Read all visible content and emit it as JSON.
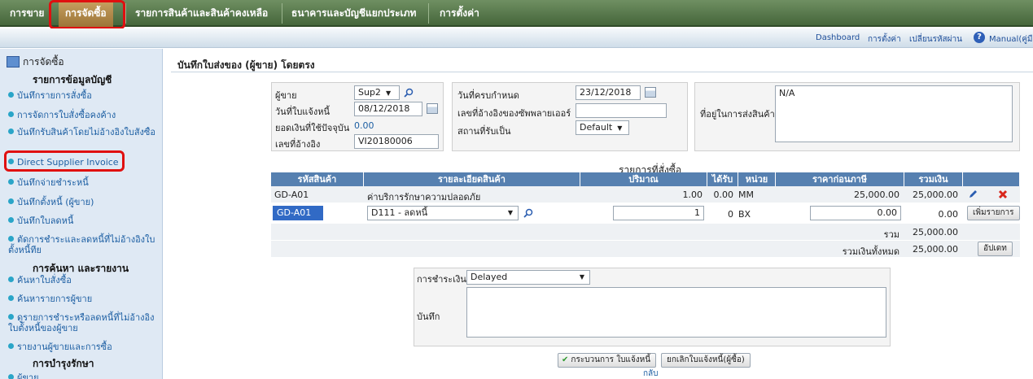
{
  "nav": {
    "tabs": [
      "การขาย",
      "การจัดซื้อ",
      "รายการสินค้าและสินค้าคงเหลือ",
      "ธนาคารและบัญชีแยกประเภท",
      "การตั้งค่า"
    ]
  },
  "subnav": {
    "links": [
      "Dashboard",
      "การตั้งค่า",
      "เปลี่ยนรหัสผ่าน",
      "Manual(คู่มือ"
    ]
  },
  "sidebar": {
    "header": "การจัดซื้อ",
    "section_accounts": "รายการข้อมูลบัญชี",
    "items": [
      "บันทึกรายการสั่งซื้อ",
      "การจัดการใบสั่งซื้อคงค้าง",
      "บันทึกรับสินค้าโดยไม่อ้างอิงใบสั่งซื้อ",
      "Direct Supplier Invoice",
      "บันทึกจ่ายชำระหนี้",
      "บันทึกตั้งหนี้ (ผู้ขาย)",
      "บันทึกใบลดหนี้",
      "ตัดการชำระและลดหนี้ที่ไม่อ้างอิงใบตั้งหนี้ทีย"
    ],
    "section_reports": "การค้นหา และรายงาน",
    "report_items": [
      "ค้นหาใบสั่งซื้อ",
      "ค้นหารายการผู้ขาย",
      "ดูรายการชำระหรือลดหนี้ที่ไม่อ้างอิงใบตั้งหนี้ของผู้ขาย",
      "รายงานผู้ขายและการซื้อ"
    ],
    "section_maint": "การบำรุงรักษา",
    "maint_items": [
      "ผู้ขาย"
    ]
  },
  "page": {
    "title": "บันทึกใบส่งของ (ผู้ขาย) โดยตรง"
  },
  "form": {
    "supplier_label": "ผู้ขาย",
    "supplier_value": "Sup2",
    "invoice_date_label": "วันที่ใบแจ้งหนี้",
    "invoice_date_value": "08/12/2018",
    "balance_label": "ยอดเงินที่ใช้ปัจจุบัน",
    "balance_value": "0.00",
    "reference_label": "เลขที่อ้างอิง",
    "reference_value": "VI20180006",
    "due_date_label": "วันที่ครบกำหนด",
    "due_date_value": "23/12/2018",
    "supplier_ref_label": "เลขที่อ้างอิงของซัพพลายเออร์",
    "supplier_ref_value": "",
    "location_label": "สถานที่รับเป็น",
    "location_value": "Default",
    "delivery_address_label": "ที่อยู่ในการส่งสินค้า",
    "delivery_address_value": "N/A"
  },
  "items": {
    "caption": "รายการที่สั่งซื้อ",
    "headers": [
      "รหัสสินค้า",
      "รายละเอียดสินค้า",
      "ปริมาณ",
      "ได้รับ",
      "หน่วย",
      "ราคาก่อนภาษี",
      "รวมเงิน"
    ],
    "row1": {
      "code": "GD-A01",
      "description": "ค่าบริการรักษาความปลอดภัย",
      "qty": "1.00",
      "received": "0.00",
      "unit": "MM",
      "price": "25,000.00",
      "total": "25,000.00"
    },
    "entry": {
      "code": "GD-A01",
      "description": "D111 - ลดหนี้",
      "qty": "1",
      "received": "0",
      "unit": "BX",
      "price": "0.00",
      "total": "0.00",
      "add_button": "เพิ่มรายการ"
    },
    "subtotal_label": "รวม",
    "subtotal_value": "25,000.00",
    "grand_total_label": "รวมเงินทั้งหมด",
    "grand_total_value": "25,000.00",
    "update_button": "อัปเดท"
  },
  "payment": {
    "terms_label": "การชำระเงิน",
    "terms_value": "Delayed",
    "memo_label": "บันทึก",
    "memo_value": ""
  },
  "actions": {
    "process_button": "กระบวนการ ใบแจ้งหนี้",
    "cancel_button": "ยกเลิกใบแจ้งหนี้(ผู้ซื้อ)",
    "back_link": "กลับ"
  },
  "colors": {
    "highlight": "#e01010",
    "nav_active": "#b48a4c",
    "table_header": "#5680b0"
  }
}
